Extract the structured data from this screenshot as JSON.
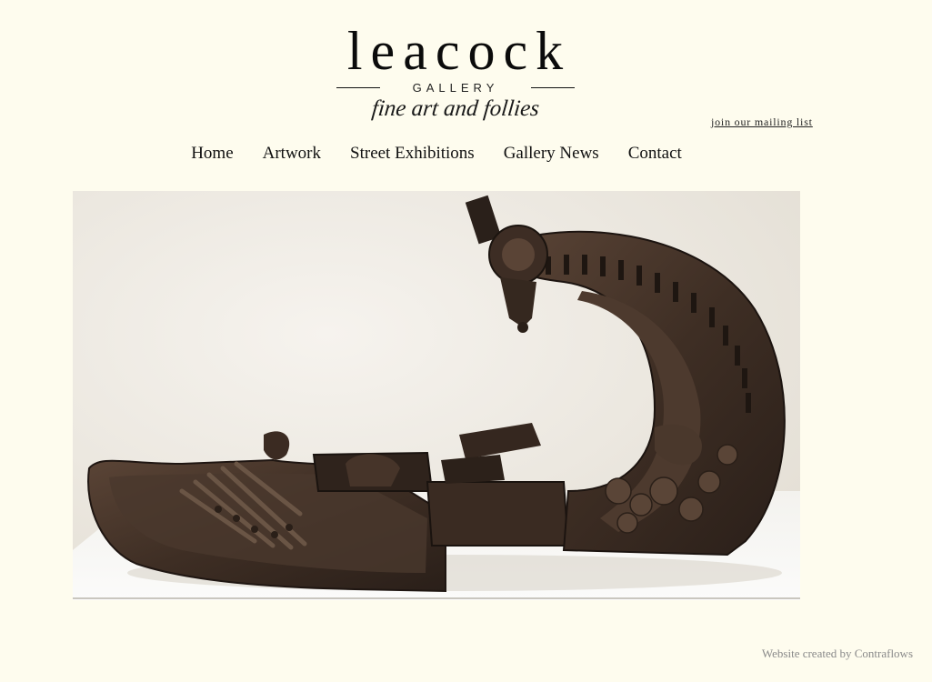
{
  "logo": {
    "wordmark": "leacock",
    "subtitle": "GALLERY",
    "tagline": "fine art and follies"
  },
  "header": {
    "mailing_list_link": "join our mailing list"
  },
  "nav": {
    "items": [
      {
        "label": "Home"
      },
      {
        "label": "Artwork"
      },
      {
        "label": "Street Exhibitions"
      },
      {
        "label": "Gallery News"
      },
      {
        "label": "Contact"
      }
    ]
  },
  "hero": {
    "image_caption": "",
    "colors": {
      "wall": "#f0ece4",
      "plinth": "#f7f6f3",
      "bronze": "#3f2f26"
    }
  },
  "footer": {
    "credit": "Website created by Contraflows"
  },
  "colors": {
    "background": "#fefcee",
    "text": "#111111",
    "muted": "#8a8a8a"
  }
}
